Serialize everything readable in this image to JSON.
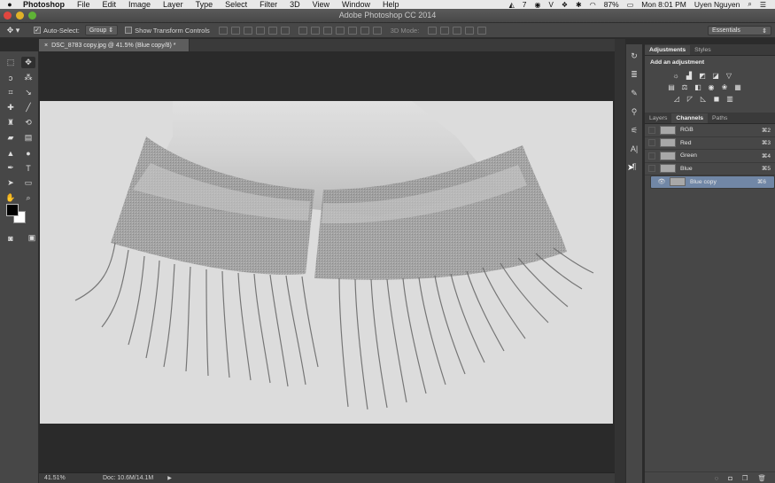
{
  "menubar": {
    "app": "Photoshop",
    "items": [
      "File",
      "Edit",
      "Image",
      "Layer",
      "Type",
      "Select",
      "Filter",
      "3D",
      "View",
      "Window",
      "Help"
    ],
    "right": {
      "badge": "7",
      "battery": "87%",
      "time": "Mon 8:01 PM",
      "user": "Uyen Nguyen"
    }
  },
  "window": {
    "title": "Adobe Photoshop CC 2014"
  },
  "options": {
    "auto_select_label": "Auto-Select:",
    "auto_select_value": "Group",
    "show_transform_label": "Show Transform Controls",
    "mode3d_label": "3D Mode:",
    "workspace": "Essentials"
  },
  "document": {
    "tab_title": "DSC_8783 copy.jpg @ 41.5% (Blue copy/8) *",
    "zoom": "41.51%",
    "doc_size": "Doc: 10.6M/14.1M"
  },
  "adjustments_panel": {
    "tabs": [
      "Adjustments",
      "Styles"
    ],
    "heading": "Add an adjustment"
  },
  "channels_panel": {
    "tabs": [
      "Layers",
      "Channels",
      "Paths"
    ],
    "channels": [
      {
        "name": "RGB",
        "shortcut": "⌘2",
        "visible": false,
        "selected": false
      },
      {
        "name": "Red",
        "shortcut": "⌘3",
        "visible": false,
        "selected": false
      },
      {
        "name": "Green",
        "shortcut": "⌘4",
        "visible": false,
        "selected": false
      },
      {
        "name": "Blue",
        "shortcut": "⌘5",
        "visible": false,
        "selected": false
      },
      {
        "name": "Blue copy",
        "shortcut": "⌘6",
        "visible": true,
        "selected": true
      }
    ]
  },
  "colors": {
    "selection": "#7187a6",
    "foreground": "#000000",
    "background": "#ffffff"
  }
}
